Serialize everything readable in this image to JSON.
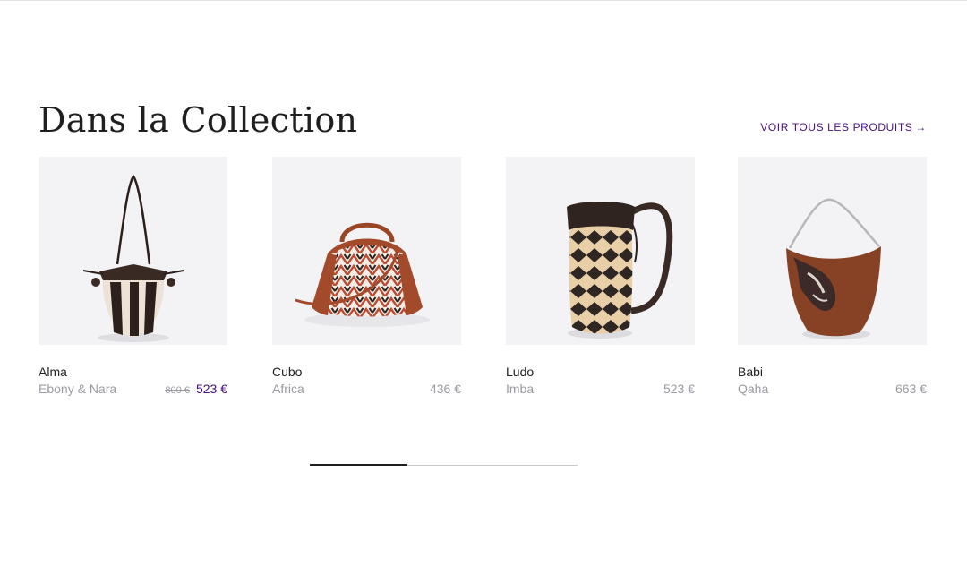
{
  "section": {
    "title": "Dans la Collection",
    "see_all_label": "VOIR TOUS LES PRODUITS",
    "see_all_arrow": "→"
  },
  "colors": {
    "accent": "#4a1083",
    "muted_text": "#9a9aa3",
    "image_background": "#f3f3f5"
  },
  "products": [
    {
      "name": "Alma",
      "variant": "Ebony & Nara",
      "old_price": "800 €",
      "price": "523 €"
    },
    {
      "name": "Cubo",
      "variant": "Africa",
      "price": "436 €"
    },
    {
      "name": "Ludo",
      "variant": "Imba",
      "price": "523 €"
    },
    {
      "name": "Babi",
      "variant": "Qaha",
      "price": "663 €"
    }
  ],
  "carousel": {
    "progress_fraction": 0.366
  }
}
